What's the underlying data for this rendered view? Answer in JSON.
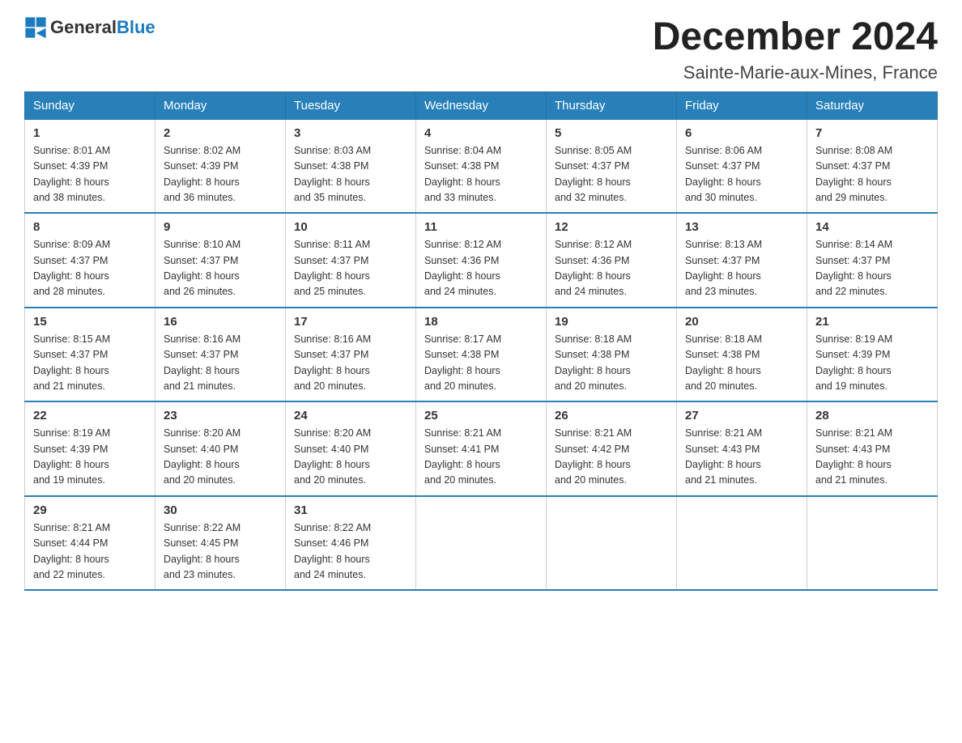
{
  "header": {
    "logo_general": "General",
    "logo_blue": "Blue",
    "title": "December 2024",
    "subtitle": "Sainte-Marie-aux-Mines, France"
  },
  "weekdays": [
    "Sunday",
    "Monday",
    "Tuesday",
    "Wednesday",
    "Thursday",
    "Friday",
    "Saturday"
  ],
  "weeks": [
    [
      {
        "day": "1",
        "sunrise": "8:01 AM",
        "sunset": "4:39 PM",
        "daylight": "8 hours and 38 minutes."
      },
      {
        "day": "2",
        "sunrise": "8:02 AM",
        "sunset": "4:39 PM",
        "daylight": "8 hours and 36 minutes."
      },
      {
        "day": "3",
        "sunrise": "8:03 AM",
        "sunset": "4:38 PM",
        "daylight": "8 hours and 35 minutes."
      },
      {
        "day": "4",
        "sunrise": "8:04 AM",
        "sunset": "4:38 PM",
        "daylight": "8 hours and 33 minutes."
      },
      {
        "day": "5",
        "sunrise": "8:05 AM",
        "sunset": "4:37 PM",
        "daylight": "8 hours and 32 minutes."
      },
      {
        "day": "6",
        "sunrise": "8:06 AM",
        "sunset": "4:37 PM",
        "daylight": "8 hours and 30 minutes."
      },
      {
        "day": "7",
        "sunrise": "8:08 AM",
        "sunset": "4:37 PM",
        "daylight": "8 hours and 29 minutes."
      }
    ],
    [
      {
        "day": "8",
        "sunrise": "8:09 AM",
        "sunset": "4:37 PM",
        "daylight": "8 hours and 28 minutes."
      },
      {
        "day": "9",
        "sunrise": "8:10 AM",
        "sunset": "4:37 PM",
        "daylight": "8 hours and 26 minutes."
      },
      {
        "day": "10",
        "sunrise": "8:11 AM",
        "sunset": "4:37 PM",
        "daylight": "8 hours and 25 minutes."
      },
      {
        "day": "11",
        "sunrise": "8:12 AM",
        "sunset": "4:36 PM",
        "daylight": "8 hours and 24 minutes."
      },
      {
        "day": "12",
        "sunrise": "8:12 AM",
        "sunset": "4:36 PM",
        "daylight": "8 hours and 24 minutes."
      },
      {
        "day": "13",
        "sunrise": "8:13 AM",
        "sunset": "4:37 PM",
        "daylight": "8 hours and 23 minutes."
      },
      {
        "day": "14",
        "sunrise": "8:14 AM",
        "sunset": "4:37 PM",
        "daylight": "8 hours and 22 minutes."
      }
    ],
    [
      {
        "day": "15",
        "sunrise": "8:15 AM",
        "sunset": "4:37 PM",
        "daylight": "8 hours and 21 minutes."
      },
      {
        "day": "16",
        "sunrise": "8:16 AM",
        "sunset": "4:37 PM",
        "daylight": "8 hours and 21 minutes."
      },
      {
        "day": "17",
        "sunrise": "8:16 AM",
        "sunset": "4:37 PM",
        "daylight": "8 hours and 20 minutes."
      },
      {
        "day": "18",
        "sunrise": "8:17 AM",
        "sunset": "4:38 PM",
        "daylight": "8 hours and 20 minutes."
      },
      {
        "day": "19",
        "sunrise": "8:18 AM",
        "sunset": "4:38 PM",
        "daylight": "8 hours and 20 minutes."
      },
      {
        "day": "20",
        "sunrise": "8:18 AM",
        "sunset": "4:38 PM",
        "daylight": "8 hours and 20 minutes."
      },
      {
        "day": "21",
        "sunrise": "8:19 AM",
        "sunset": "4:39 PM",
        "daylight": "8 hours and 19 minutes."
      }
    ],
    [
      {
        "day": "22",
        "sunrise": "8:19 AM",
        "sunset": "4:39 PM",
        "daylight": "8 hours and 19 minutes."
      },
      {
        "day": "23",
        "sunrise": "8:20 AM",
        "sunset": "4:40 PM",
        "daylight": "8 hours and 20 minutes."
      },
      {
        "day": "24",
        "sunrise": "8:20 AM",
        "sunset": "4:40 PM",
        "daylight": "8 hours and 20 minutes."
      },
      {
        "day": "25",
        "sunrise": "8:21 AM",
        "sunset": "4:41 PM",
        "daylight": "8 hours and 20 minutes."
      },
      {
        "day": "26",
        "sunrise": "8:21 AM",
        "sunset": "4:42 PM",
        "daylight": "8 hours and 20 minutes."
      },
      {
        "day": "27",
        "sunrise": "8:21 AM",
        "sunset": "4:43 PM",
        "daylight": "8 hours and 21 minutes."
      },
      {
        "day": "28",
        "sunrise": "8:21 AM",
        "sunset": "4:43 PM",
        "daylight": "8 hours and 21 minutes."
      }
    ],
    [
      {
        "day": "29",
        "sunrise": "8:21 AM",
        "sunset": "4:44 PM",
        "daylight": "8 hours and 22 minutes."
      },
      {
        "day": "30",
        "sunrise": "8:22 AM",
        "sunset": "4:45 PM",
        "daylight": "8 hours and 23 minutes."
      },
      {
        "day": "31",
        "sunrise": "8:22 AM",
        "sunset": "4:46 PM",
        "daylight": "8 hours and 24 minutes."
      },
      null,
      null,
      null,
      null
    ]
  ],
  "labels": {
    "sunrise": "Sunrise:",
    "sunset": "Sunset:",
    "daylight": "Daylight:"
  }
}
